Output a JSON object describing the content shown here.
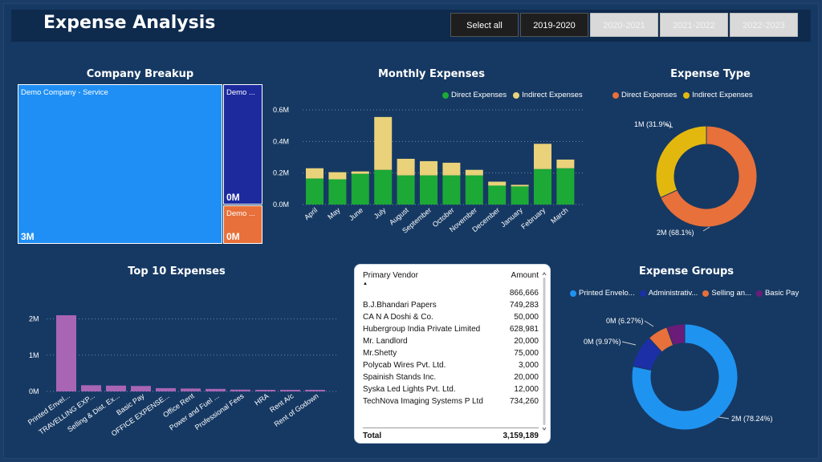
{
  "header": {
    "title": "Expense Analysis",
    "slicer": [
      {
        "label": "Select all",
        "state": "dark"
      },
      {
        "label": "2019-2020",
        "state": "dark"
      },
      {
        "label": "2020-2021",
        "state": "light"
      },
      {
        "label": "2021-2022",
        "state": "light"
      },
      {
        "label": "2022-2023",
        "state": "light"
      }
    ]
  },
  "colors": {
    "background": "#163963",
    "direct": "#1ca936",
    "indirect": "#e9d27a",
    "pie_direct": "#e8703a",
    "pie_indirect": "#e3b80e",
    "bar_purple": "#a865b3",
    "g_printed": "#1f93f0",
    "g_admin": "#1c2fa6",
    "g_selling": "#e8703a",
    "g_basic": "#6b1c78"
  },
  "company_breakup": {
    "title": "Company Breakup",
    "tiles": [
      {
        "name": "Demo Company - Service",
        "value": "3M",
        "color": "#1f8ff5"
      },
      {
        "name": "Demo ...",
        "value": "0M",
        "color": "#1c2a9e"
      },
      {
        "name": "Demo ...",
        "value": "0M",
        "color": "#e8703a"
      }
    ]
  },
  "table": {
    "col_vendor": "Primary Vendor",
    "col_amount": "Amount",
    "rows": [
      {
        "vendor": "",
        "amount": "866,666"
      },
      {
        "vendor": "B.J.Bhandari Papers",
        "amount": "749,283"
      },
      {
        "vendor": "CA N A Doshi & Co.",
        "amount": "50,000"
      },
      {
        "vendor": "Hubergroup India Private Limited",
        "amount": "628,981"
      },
      {
        "vendor": "Mr. Landlord",
        "amount": "20,000"
      },
      {
        "vendor": "Mr.Shetty",
        "amount": "75,000"
      },
      {
        "vendor": "Polycab Wires Pvt. Ltd.",
        "amount": "3,000"
      },
      {
        "vendor": "Spainish Stands Inc.",
        "amount": "20,000"
      },
      {
        "vendor": "Syska Led Lights Pvt. Ltd.",
        "amount": "12,000"
      },
      {
        "vendor": "TechNova Imaging Systems P Ltd",
        "amount": "734,260"
      }
    ],
    "total_label": "Total",
    "total_value": "3,159,189"
  },
  "chart_data": [
    {
      "id": "monthly",
      "type": "bar",
      "stacked": true,
      "title": "Monthly Expenses",
      "categories": [
        "April",
        "May",
        "June",
        "July",
        "August",
        "September",
        "October",
        "November",
        "December",
        "January",
        "February",
        "March"
      ],
      "series": [
        {
          "name": "Direct Expenses",
          "values": [
            0.165,
            0.16,
            0.195,
            0.22,
            0.185,
            0.185,
            0.185,
            0.185,
            0.12,
            0.115,
            0.225,
            0.23
          ]
        },
        {
          "name": "Indirect Expenses",
          "values": [
            0.065,
            0.045,
            0.015,
            0.335,
            0.105,
            0.09,
            0.08,
            0.035,
            0.025,
            0.01,
            0.16,
            0.055
          ]
        }
      ],
      "yticks": [
        "0.0M",
        "0.2M",
        "0.4M",
        "0.6M"
      ],
      "ylim": [
        0,
        0.6
      ],
      "legend": "top-right"
    },
    {
      "id": "expense_type",
      "type": "pie",
      "title": "Expense Type",
      "donut": true,
      "slices": [
        {
          "name": "Direct Expenses",
          "value": 68.1,
          "label": "2M (68.1%)"
        },
        {
          "name": "Indirect Expenses",
          "value": 31.9,
          "label": "1M (31.9%)"
        }
      ]
    },
    {
      "id": "top10",
      "type": "bar",
      "title": "Top 10 Expenses",
      "categories": [
        "Printed Envel...",
        "TRAVELLING EXP...",
        "Selling & Dist. Ex...",
        "Basic Pay",
        "OFFICE EXPENSE...",
        "Office Rent",
        "Power and Fuel ...",
        "Professional Fees",
        "HRA",
        "Rent A/c",
        "Rent of Godown"
      ],
      "values": [
        2.1,
        0.17,
        0.16,
        0.15,
        0.09,
        0.08,
        0.07,
        0.05,
        0.04,
        0.035,
        0.03
      ],
      "yticks": [
        "0M",
        "1M",
        "2M"
      ],
      "ylim": [
        0,
        2.3
      ]
    },
    {
      "id": "expense_groups",
      "type": "pie",
      "title": "Expense Groups",
      "donut": true,
      "slices": [
        {
          "name": "Printed Envelo...",
          "value": 78.24,
          "label": "2M (78.24%)"
        },
        {
          "name": "Administrativ...",
          "value": 9.97,
          "label": "0M (9.97%)"
        },
        {
          "name": "Selling an...",
          "value": 6.27,
          "label": "0M (6.27%)"
        },
        {
          "name": "Basic Pay",
          "value": 5.52,
          "label": ""
        }
      ]
    }
  ]
}
